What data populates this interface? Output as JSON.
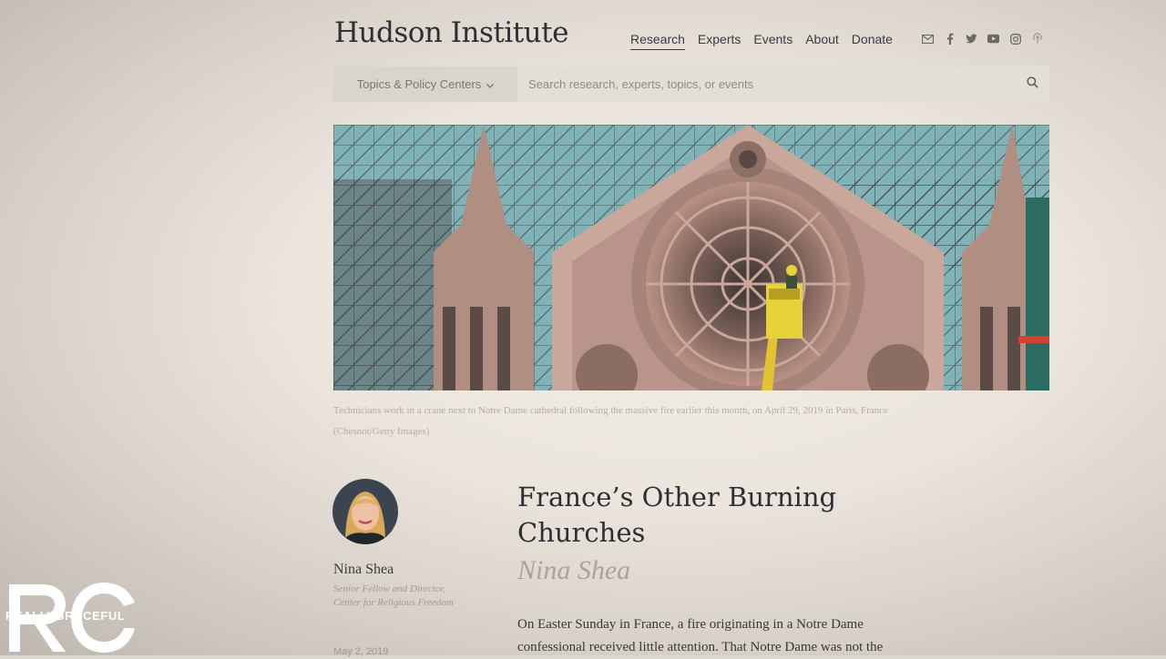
{
  "site": {
    "logo": "Hudson Institute"
  },
  "nav": {
    "items": [
      "Research",
      "Experts",
      "Events",
      "About",
      "Donate"
    ]
  },
  "social_icons": [
    "mail-icon",
    "facebook-icon",
    "twitter-icon",
    "youtube-icon",
    "instagram-icon",
    "podcast-icon"
  ],
  "search": {
    "topics_label": "Topics & Policy Centers",
    "placeholder": "Search research, experts, topics, or events"
  },
  "hero": {
    "caption": "Technicians work in a crane next to Notre Dame cathedral following the massive fire earlier this month, on April 29, 2019 in Paris, France",
    "credit": "(Chesnot/Getty Images)"
  },
  "author": {
    "name": "Nina Shea",
    "role_line1": "Senior Fellow and Director,",
    "role_line2": "Center for Religious Freedom",
    "date": "May 2, 2019"
  },
  "article": {
    "title_line1": "France’s Other Burning",
    "title_line2": "Churches",
    "byline": "Nina Shea",
    "body_line1": "On Easter Sunday in France, a fire originating in a Notre Dame",
    "body_line2": "confessional received little attention. That Notre Dame was not the"
  },
  "watermark": {
    "letters": "RG",
    "text": "REALLYGRACEFUL"
  },
  "colors": {
    "sky": "#7fb3b8",
    "stone": "#c9a79a",
    "crane": "#e8d23a",
    "text": "#2f2e33"
  }
}
